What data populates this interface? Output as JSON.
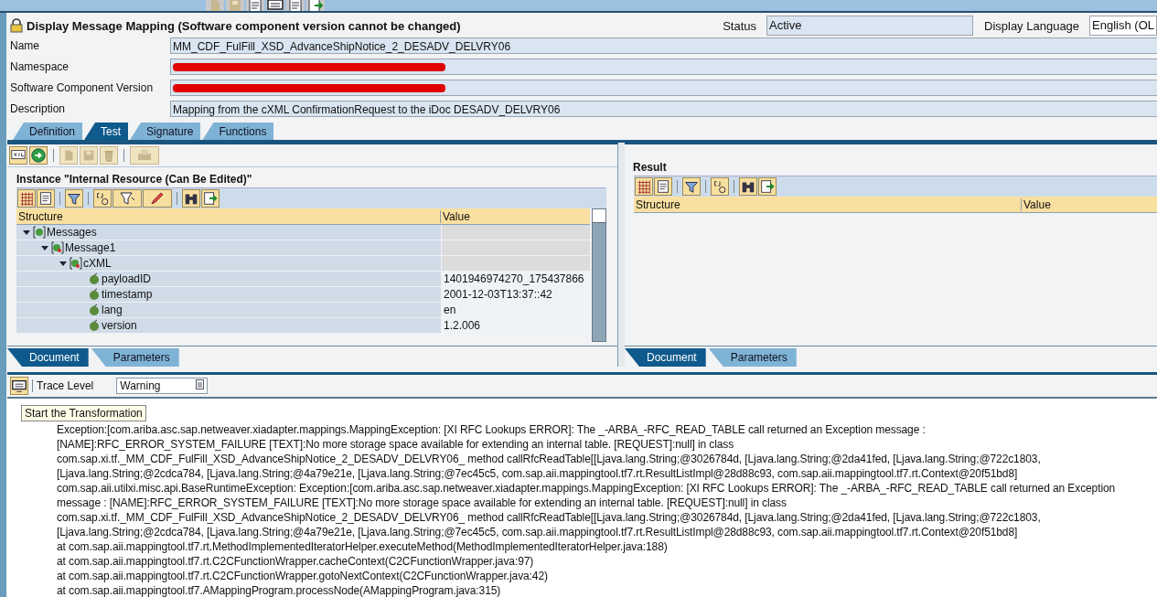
{
  "title": "Display Message Mapping (Software component version cannot be changed)",
  "status": {
    "label": "Status",
    "value": "Active"
  },
  "display_language": {
    "label": "Display Language",
    "value": "English (OL"
  },
  "fields": [
    {
      "label": "Name",
      "kind": "text",
      "value": "MM_CDF_FulFill_XSD_AdvanceShipNotice_2_DESADV_DELVRY06"
    },
    {
      "label": "Namespace",
      "kind": "redacted"
    },
    {
      "label": "Software Component Version",
      "kind": "redacted"
    },
    {
      "label": "Description",
      "kind": "text",
      "value": "Mapping from the cXML ConfirmationRequest to the iDoc DESADV_DELVRY06"
    }
  ],
  "tabs": [
    {
      "label": "Definition",
      "selected": false
    },
    {
      "label": "Test",
      "selected": true
    },
    {
      "label": "Signature",
      "selected": false
    },
    {
      "label": "Functions",
      "selected": false
    }
  ],
  "instance": {
    "title": "Instance \"Internal Resource (Can Be Edited)\"",
    "columns": [
      "Structure",
      "Value"
    ],
    "tree": [
      {
        "label": "Messages",
        "kind": "root",
        "expanded": true,
        "children": [
          {
            "label": "Message1",
            "kind": "element",
            "expanded": true,
            "children": [
              {
                "label": "cXML",
                "kind": "element",
                "expanded": true,
                "children": [
                  {
                    "label": "payloadID",
                    "kind": "attribute",
                    "value": "1401946974270_175437866"
                  },
                  {
                    "label": "timestamp",
                    "kind": "attribute",
                    "value": "2001-12-03T13:37::42"
                  },
                  {
                    "label": "lang",
                    "kind": "attribute",
                    "value": "en"
                  },
                  {
                    "label": "version",
                    "kind": "attribute",
                    "value": "1.2.006"
                  }
                ]
              }
            ]
          }
        ]
      }
    ],
    "tabs": [
      {
        "label": "Document",
        "selected": true
      },
      {
        "label": "Parameters",
        "selected": false
      }
    ]
  },
  "result": {
    "title": "Result",
    "columns": [
      "Structure",
      "Value"
    ],
    "tabs": [
      {
        "label": "Document",
        "selected": true
      },
      {
        "label": "Parameters",
        "selected": false
      }
    ]
  },
  "trace": {
    "label": "Trace Level",
    "value": "Warning"
  },
  "tooltip": "Start the Transformation",
  "log": [
    "Exception:[com.ariba.asc.sap.netweaver.xiadapter.mappings.MappingException: [XI RFC Lookups ERROR]: The _-ARBA_-RFC_READ_TABLE call returned an Exception message :",
    "[NAME]:RFC_ERROR_SYSTEM_FAILURE [TEXT]:No more storage space available for extending an internal table. [REQUEST]:null] in class",
    "com.sap.xi.tf._MM_CDF_FulFill_XSD_AdvanceShipNotice_2_DESADV_DELVRY06_ method callRfcReadTable[[Ljava.lang.String;@3026784d, [Ljava.lang.String;@2da41fed, [Ljava.lang.String;@722c1803,",
    "[Ljava.lang.String;@2cdca784, [Ljava.lang.String;@4a79e21e, [Ljava.lang.String;@7ec45c5, com.sap.aii.mappingtool.tf7.rt.ResultListImpl@28d88c93, com.sap.aii.mappingtool.tf7.rt.Context@20f51bd8]",
    "com.sap.aii.utilxi.misc.api.BaseRuntimeException: Exception:[com.ariba.asc.sap.netweaver.xiadapter.mappings.MappingException: [XI RFC Lookups ERROR]: The _-ARBA_-RFC_READ_TABLE call returned an Exception",
    "message : [NAME]:RFC_ERROR_SYSTEM_FAILURE [TEXT]:No more storage space available for extending an internal table. [REQUEST]:null] in class",
    "com.sap.xi.tf._MM_CDF_FulFill_XSD_AdvanceShipNotice_2_DESADV_DELVRY06_ method callRfcReadTable[[Ljava.lang.String;@3026784d, [Ljava.lang.String;@2da41fed, [Ljava.lang.String;@722c1803,",
    "[Ljava.lang.String;@2cdca784, [Ljava.lang.String;@4a79e21e, [Ljava.lang.String;@7ec45c5, com.sap.aii.mappingtool.tf7.rt.ResultListImpl@28d88c93, com.sap.aii.mappingtool.tf7.rt.Context@20f51bd8]",
    "at com.sap.aii.mappingtool.tf7.rt.MethodImplementedIteratorHelper.executeMethod(MethodImplementedIteratorHelper.java:188)",
    "at com.sap.aii.mappingtool.tf7.rt.C2CFunctionWrapper.cacheContext(C2CFunctionWrapper.java:97)",
    "at com.sap.aii.mappingtool.tf7.rt.C2CFunctionWrapper.gotoNextContext(C2CFunctionWrapper.java:42)",
    "at com.sap.aii.mappingtool.tf7.AMappingProgram.processNode(AMappingProgram.java:315)"
  ]
}
